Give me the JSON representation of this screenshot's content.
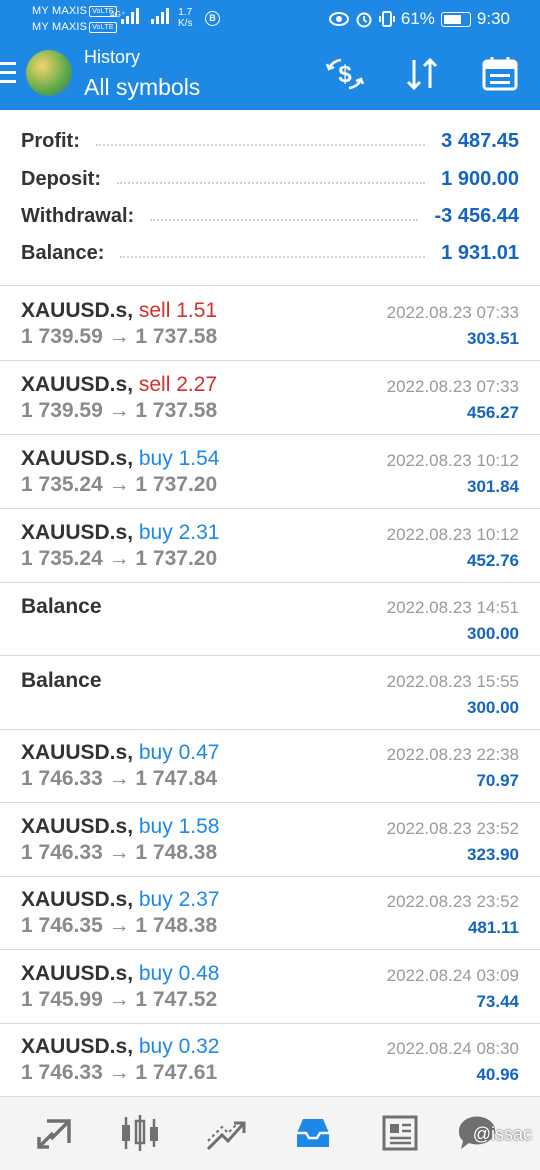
{
  "status_bar": {
    "carrier1": "MY MAXIS",
    "carrier2": "MY MAXIS",
    "volte": "VoLTE",
    "net_type": "4G⁺",
    "speed_value": "1.7",
    "speed_unit": "K/s",
    "b_badge": "B",
    "battery_pct": "61%",
    "time": "9:30"
  },
  "header": {
    "subtitle": "History",
    "title": "All symbols",
    "accent": "#1e88e5"
  },
  "summary": [
    {
      "label": "Profit:",
      "value": "3 487.45"
    },
    {
      "label": "Deposit:",
      "value": "1 900.00"
    },
    {
      "label": "Withdrawal:",
      "value": "-3 456.44"
    },
    {
      "label": "Balance:",
      "value": "1 931.01"
    }
  ],
  "deals": [
    {
      "symbol": "XAUUSD.s,",
      "side": "sell 1.51",
      "side_type": "sell",
      "prices": "1 739.59 → 1 737.58",
      "time": "2022.08.23 07:33",
      "profit": "303.51"
    },
    {
      "symbol": "XAUUSD.s,",
      "side": "sell 2.27",
      "side_type": "sell",
      "prices": "1 739.59 → 1 737.58",
      "time": "2022.08.23 07:33",
      "profit": "456.27"
    },
    {
      "symbol": "XAUUSD.s,",
      "side": "buy 1.54",
      "side_type": "buy",
      "prices": "1 735.24 → 1 737.20",
      "time": "2022.08.23 10:12",
      "profit": "301.84"
    },
    {
      "symbol": "XAUUSD.s,",
      "side": "buy 2.31",
      "side_type": "buy",
      "prices": "1 735.24 → 1 737.20",
      "time": "2022.08.23 10:12",
      "profit": "452.76"
    },
    {
      "symbol": "Balance",
      "side": "",
      "side_type": "none",
      "prices": "",
      "time": "2022.08.23 14:51",
      "profit": "300.00"
    },
    {
      "symbol": "Balance",
      "side": "",
      "side_type": "none",
      "prices": "",
      "time": "2022.08.23 15:55",
      "profit": "300.00"
    },
    {
      "symbol": "XAUUSD.s,",
      "side": "buy 0.47",
      "side_type": "buy",
      "prices": "1 746.33 → 1 747.84",
      "time": "2022.08.23 22:38",
      "profit": "70.97"
    },
    {
      "symbol": "XAUUSD.s,",
      "side": "buy 1.58",
      "side_type": "buy",
      "prices": "1 746.33 → 1 748.38",
      "time": "2022.08.23 23:52",
      "profit": "323.90"
    },
    {
      "symbol": "XAUUSD.s,",
      "side": "buy 2.37",
      "side_type": "buy",
      "prices": "1 746.35 → 1 748.38",
      "time": "2022.08.23 23:52",
      "profit": "481.11"
    },
    {
      "symbol": "XAUUSD.s,",
      "side": "buy 0.48",
      "side_type": "buy",
      "prices": "1 745.99 → 1 747.52",
      "time": "2022.08.24 03:09",
      "profit": "73.44"
    },
    {
      "symbol": "XAUUSD.s,",
      "side": "buy 0.32",
      "side_type": "buy",
      "prices": "1 746.33 → 1 747.61",
      "time": "2022.08.24 08:30",
      "profit": "40.96"
    }
  ],
  "bottom_nav": {
    "items": [
      "quotes-icon",
      "chart-icon",
      "trade-icon",
      "history-icon",
      "news-icon",
      "chat-icon"
    ],
    "active": "history-icon"
  },
  "watermark": "@issac"
}
